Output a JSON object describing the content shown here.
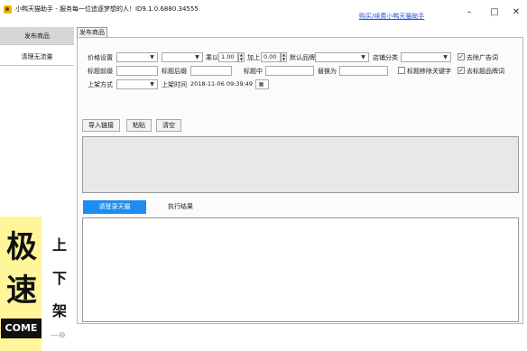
{
  "window": {
    "title": "小鸭天猫助手 - 服务每一位追逐梦想的人！ID9.1.0.6880.34555",
    "link": "购买/续费小鸭天猫助手",
    "min": "–",
    "max": "□",
    "close": "✕"
  },
  "sidebar": {
    "items": [
      {
        "label": "发布商品",
        "active": true
      },
      {
        "label": "清理无流量",
        "active": false
      }
    ],
    "promo": {
      "big1": "极",
      "big2": "速",
      "come": "COME",
      "small1": "上",
      "small2": "下",
      "small3": "架",
      "arrow": "—⊖"
    }
  },
  "tabs": {
    "release": "发布商品"
  },
  "form": {
    "price_label": "价格设置",
    "multiply_label": "乘以",
    "multiply_value": "1.00",
    "add_label": "加上",
    "add_value": "0.00",
    "default_brand_label": "默认品牌",
    "store_category_label": "店铺分类",
    "remove_ad_label": "去除广告词",
    "remove_ad_checked": true,
    "title_prefix_label": "标题前缀",
    "title_suffix_label": "标题后缀",
    "title_middle_label": "标题中",
    "replace_label": "替换为",
    "title_move_keyword_label": "标题移除关键字",
    "title_move_keyword_checked": false,
    "remove_brand_word_label": "去标题品牌词",
    "remove_brand_word_checked": true,
    "listing_method_label": "上架方式",
    "listing_time_label": "上架时间",
    "listing_time_value": "2018-11-06 09:39:49"
  },
  "actions": {
    "import": "导入链接",
    "paste": "粘贴",
    "clear": "清空"
  },
  "tabs2": {
    "active": "请登录天猫",
    "result": "执行结果"
  },
  "icons": {
    "dropdown": "chevron-down-icon",
    "calendar": "calendar-icon",
    "check": "checkmark-icon"
  },
  "colors": {
    "accent": "#1f8cf0",
    "link": "#2a4fcf",
    "promo": "#fff59a"
  }
}
